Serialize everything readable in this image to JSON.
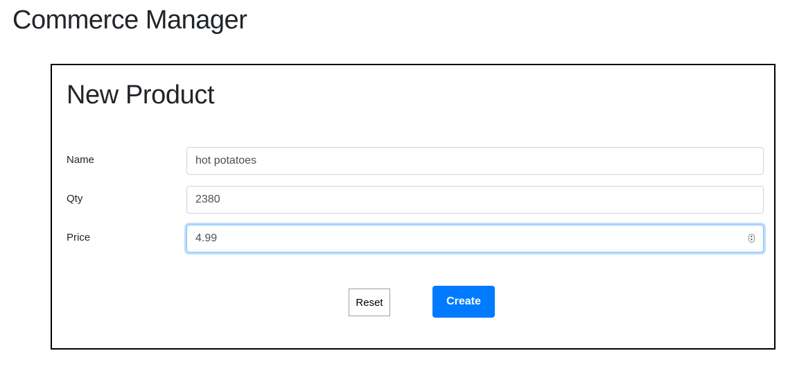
{
  "app": {
    "title": "Commerce Manager"
  },
  "form": {
    "title": "New Product",
    "fields": [
      {
        "label": "Name",
        "value": "hot potatoes"
      },
      {
        "label": "Qty",
        "value": "2380"
      },
      {
        "label": "Price",
        "value": "4.99"
      }
    ],
    "reset_label": "Reset",
    "create_label": "Create"
  },
  "colors": {
    "primary": "#007bff",
    "focus_border": "#80bdff",
    "panel_border": "#000000"
  }
}
